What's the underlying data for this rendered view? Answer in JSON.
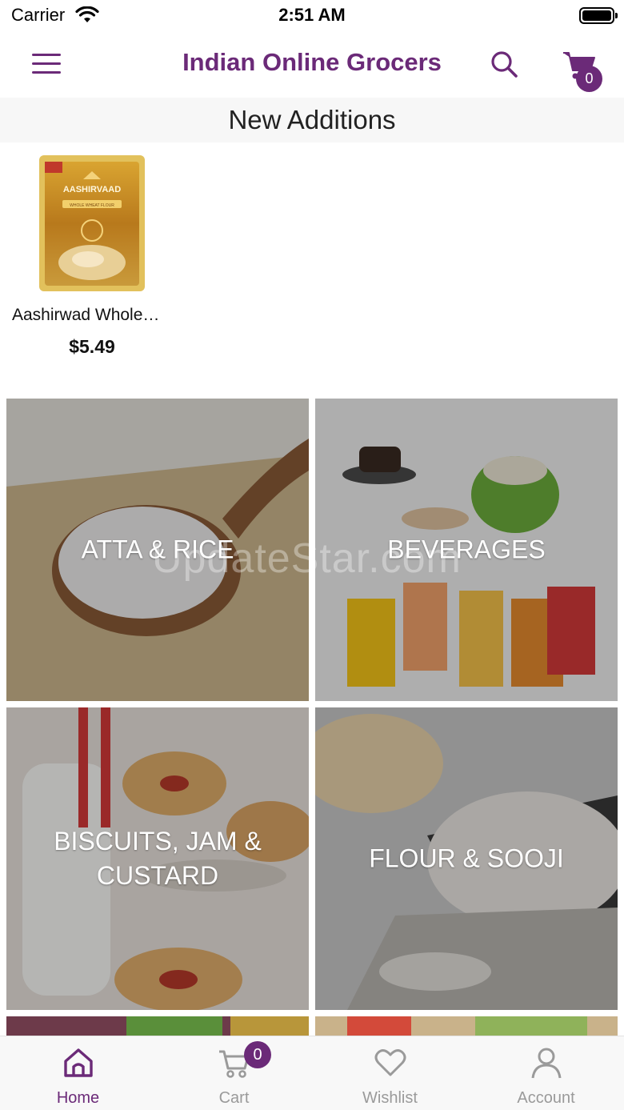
{
  "status_bar": {
    "carrier": "Carrier",
    "time": "2:51 AM"
  },
  "header": {
    "title": "Indian Online Grocers",
    "cart_count": "0",
    "icons": {
      "menu": "hamburger-icon",
      "search": "search-icon",
      "cart": "cart-icon"
    }
  },
  "section": {
    "title": "New Additions"
  },
  "products": [
    {
      "name": "Aashirwad Whole…",
      "price": "$5.49",
      "image_text": "AASHIRVAAD",
      "image_subtext": "WHOLE WHEAT FLOUR"
    }
  ],
  "categories": [
    {
      "label": "ATTA & RICE"
    },
    {
      "label": "BEVERAGES"
    },
    {
      "label": "BISCUITS, JAM & CUSTARD"
    },
    {
      "label": "FLOUR & SOOJI"
    }
  ],
  "watermark": "UpdateStar.com",
  "bottom_nav": {
    "items": [
      {
        "label": "Home",
        "icon": "home-icon",
        "active": true
      },
      {
        "label": "Cart",
        "icon": "cart-icon",
        "badge": "0"
      },
      {
        "label": "Wishlist",
        "icon": "heart-icon"
      },
      {
        "label": "Account",
        "icon": "user-icon"
      }
    ]
  },
  "colors": {
    "brand": "#6b2a78",
    "inactive": "#9a9a9a"
  }
}
